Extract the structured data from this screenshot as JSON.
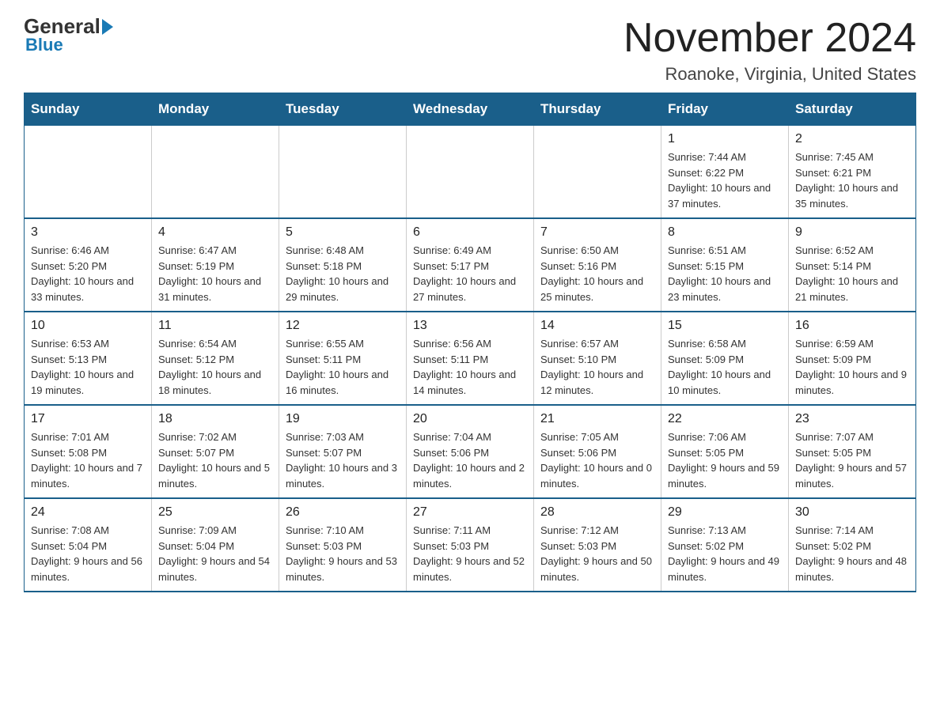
{
  "logo": {
    "general": "General",
    "blue": "Blue"
  },
  "title": "November 2024",
  "subtitle": "Roanoke, Virginia, United States",
  "days_of_week": [
    "Sunday",
    "Monday",
    "Tuesday",
    "Wednesday",
    "Thursday",
    "Friday",
    "Saturday"
  ],
  "weeks": [
    [
      {
        "day": "",
        "info": ""
      },
      {
        "day": "",
        "info": ""
      },
      {
        "day": "",
        "info": ""
      },
      {
        "day": "",
        "info": ""
      },
      {
        "day": "",
        "info": ""
      },
      {
        "day": "1",
        "info": "Sunrise: 7:44 AM\nSunset: 6:22 PM\nDaylight: 10 hours and 37 minutes."
      },
      {
        "day": "2",
        "info": "Sunrise: 7:45 AM\nSunset: 6:21 PM\nDaylight: 10 hours and 35 minutes."
      }
    ],
    [
      {
        "day": "3",
        "info": "Sunrise: 6:46 AM\nSunset: 5:20 PM\nDaylight: 10 hours and 33 minutes."
      },
      {
        "day": "4",
        "info": "Sunrise: 6:47 AM\nSunset: 5:19 PM\nDaylight: 10 hours and 31 minutes."
      },
      {
        "day": "5",
        "info": "Sunrise: 6:48 AM\nSunset: 5:18 PM\nDaylight: 10 hours and 29 minutes."
      },
      {
        "day": "6",
        "info": "Sunrise: 6:49 AM\nSunset: 5:17 PM\nDaylight: 10 hours and 27 minutes."
      },
      {
        "day": "7",
        "info": "Sunrise: 6:50 AM\nSunset: 5:16 PM\nDaylight: 10 hours and 25 minutes."
      },
      {
        "day": "8",
        "info": "Sunrise: 6:51 AM\nSunset: 5:15 PM\nDaylight: 10 hours and 23 minutes."
      },
      {
        "day": "9",
        "info": "Sunrise: 6:52 AM\nSunset: 5:14 PM\nDaylight: 10 hours and 21 minutes."
      }
    ],
    [
      {
        "day": "10",
        "info": "Sunrise: 6:53 AM\nSunset: 5:13 PM\nDaylight: 10 hours and 19 minutes."
      },
      {
        "day": "11",
        "info": "Sunrise: 6:54 AM\nSunset: 5:12 PM\nDaylight: 10 hours and 18 minutes."
      },
      {
        "day": "12",
        "info": "Sunrise: 6:55 AM\nSunset: 5:11 PM\nDaylight: 10 hours and 16 minutes."
      },
      {
        "day": "13",
        "info": "Sunrise: 6:56 AM\nSunset: 5:11 PM\nDaylight: 10 hours and 14 minutes."
      },
      {
        "day": "14",
        "info": "Sunrise: 6:57 AM\nSunset: 5:10 PM\nDaylight: 10 hours and 12 minutes."
      },
      {
        "day": "15",
        "info": "Sunrise: 6:58 AM\nSunset: 5:09 PM\nDaylight: 10 hours and 10 minutes."
      },
      {
        "day": "16",
        "info": "Sunrise: 6:59 AM\nSunset: 5:09 PM\nDaylight: 10 hours and 9 minutes."
      }
    ],
    [
      {
        "day": "17",
        "info": "Sunrise: 7:01 AM\nSunset: 5:08 PM\nDaylight: 10 hours and 7 minutes."
      },
      {
        "day": "18",
        "info": "Sunrise: 7:02 AM\nSunset: 5:07 PM\nDaylight: 10 hours and 5 minutes."
      },
      {
        "day": "19",
        "info": "Sunrise: 7:03 AM\nSunset: 5:07 PM\nDaylight: 10 hours and 3 minutes."
      },
      {
        "day": "20",
        "info": "Sunrise: 7:04 AM\nSunset: 5:06 PM\nDaylight: 10 hours and 2 minutes."
      },
      {
        "day": "21",
        "info": "Sunrise: 7:05 AM\nSunset: 5:06 PM\nDaylight: 10 hours and 0 minutes."
      },
      {
        "day": "22",
        "info": "Sunrise: 7:06 AM\nSunset: 5:05 PM\nDaylight: 9 hours and 59 minutes."
      },
      {
        "day": "23",
        "info": "Sunrise: 7:07 AM\nSunset: 5:05 PM\nDaylight: 9 hours and 57 minutes."
      }
    ],
    [
      {
        "day": "24",
        "info": "Sunrise: 7:08 AM\nSunset: 5:04 PM\nDaylight: 9 hours and 56 minutes."
      },
      {
        "day": "25",
        "info": "Sunrise: 7:09 AM\nSunset: 5:04 PM\nDaylight: 9 hours and 54 minutes."
      },
      {
        "day": "26",
        "info": "Sunrise: 7:10 AM\nSunset: 5:03 PM\nDaylight: 9 hours and 53 minutes."
      },
      {
        "day": "27",
        "info": "Sunrise: 7:11 AM\nSunset: 5:03 PM\nDaylight: 9 hours and 52 minutes."
      },
      {
        "day": "28",
        "info": "Sunrise: 7:12 AM\nSunset: 5:03 PM\nDaylight: 9 hours and 50 minutes."
      },
      {
        "day": "29",
        "info": "Sunrise: 7:13 AM\nSunset: 5:02 PM\nDaylight: 9 hours and 49 minutes."
      },
      {
        "day": "30",
        "info": "Sunrise: 7:14 AM\nSunset: 5:02 PM\nDaylight: 9 hours and 48 minutes."
      }
    ]
  ]
}
